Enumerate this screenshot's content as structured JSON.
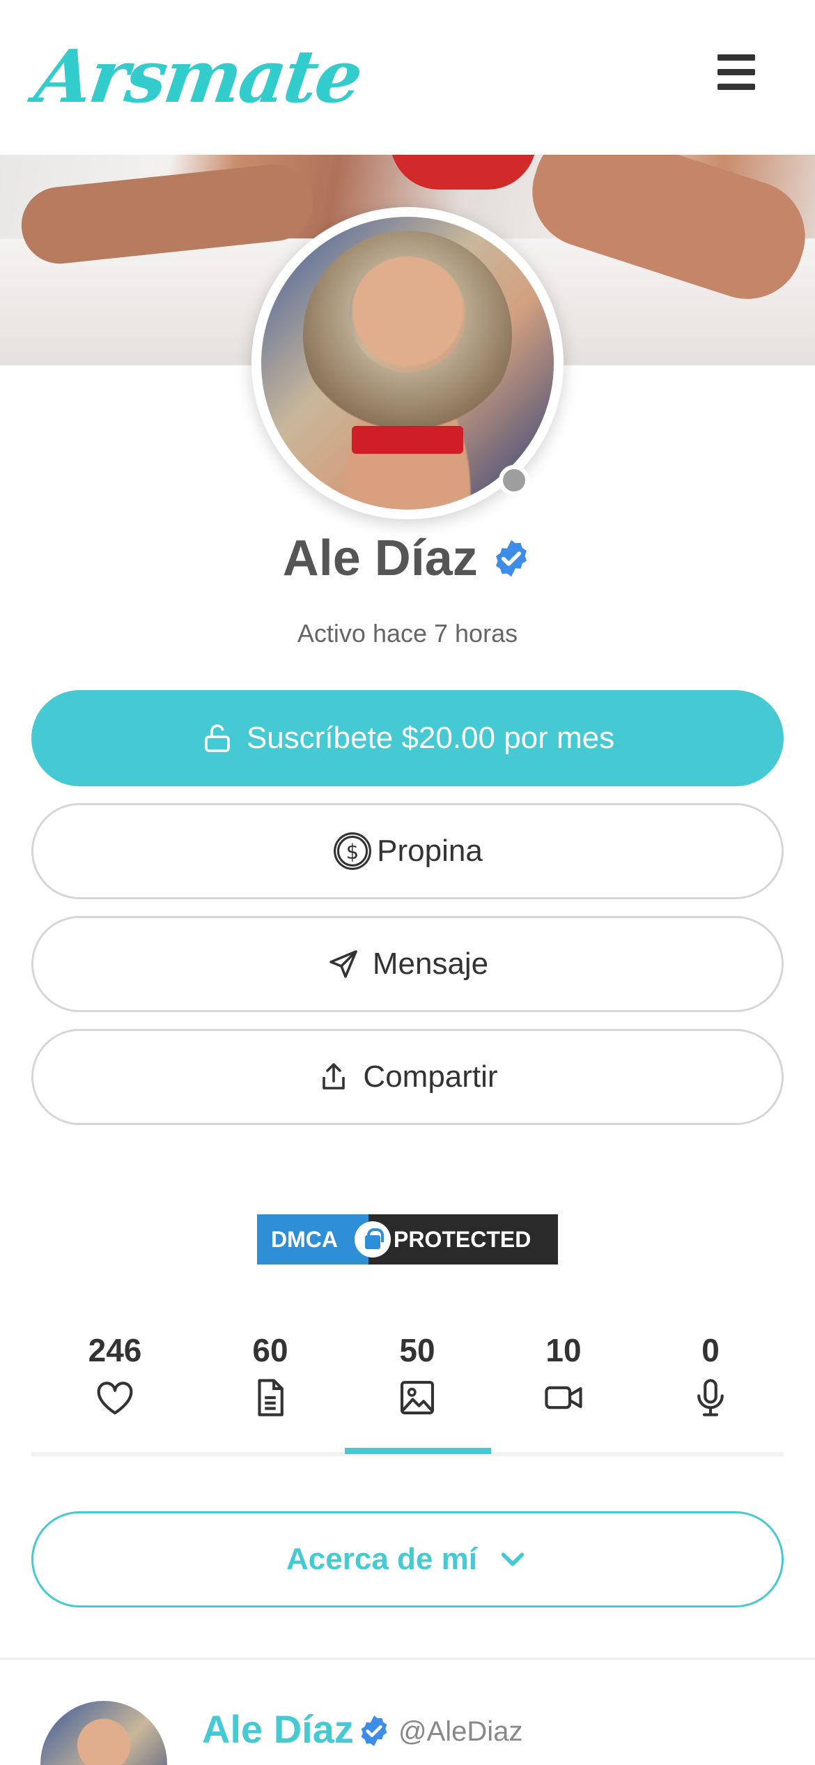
{
  "header": {
    "logo": "Arsmate",
    "menu_icon": "hamburger-menu-icon"
  },
  "profile": {
    "name": "Ale Díaz",
    "active_status": "Activo hace 7 horas",
    "online_status_color": "#9e9e9e"
  },
  "actions": {
    "subscribe_label": "Suscríbete $20.00 por mes",
    "tip_label": "Propina",
    "message_label": "Mensaje",
    "share_label": "Compartir"
  },
  "dmca": {
    "left_text": "DMCA",
    "right_text": "PROTECTED"
  },
  "stats": [
    {
      "value": "246",
      "icon": "heart-icon"
    },
    {
      "value": "60",
      "icon": "document-icon"
    },
    {
      "value": "50",
      "icon": "image-icon"
    },
    {
      "value": "10",
      "icon": "video-icon"
    },
    {
      "value": "0",
      "icon": "microphone-icon"
    }
  ],
  "about": {
    "label": "Acerca de mí"
  },
  "post": {
    "name": "Ale Díaz",
    "handle": "@AleDiaz"
  },
  "colors": {
    "accent": "#45c9d3",
    "logo": "#33cccc",
    "verified": "#3d8de8"
  }
}
